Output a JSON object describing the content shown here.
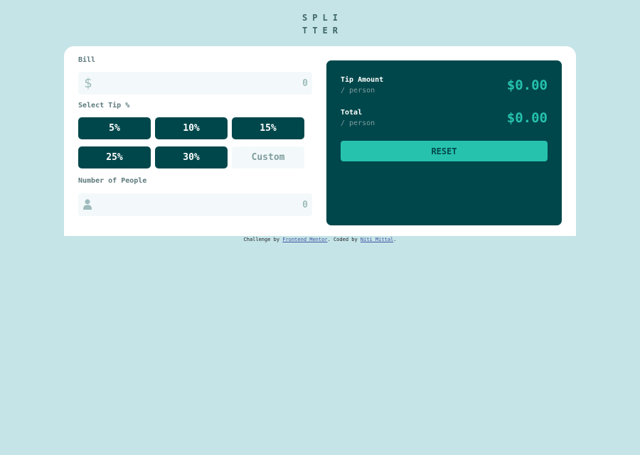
{
  "logo": {
    "line1": "SPLI",
    "line2": "TTER"
  },
  "bill": {
    "label": "Bill",
    "icon": "dollar-icon",
    "placeholder": "0"
  },
  "tip": {
    "label": "Select Tip %",
    "options": [
      "5%",
      "10%",
      "15%",
      "25%",
      "30%"
    ],
    "custom_placeholder": "Custom"
  },
  "people": {
    "label": "Number of People",
    "icon": "person-icon",
    "placeholder": "0"
  },
  "result": {
    "tip_title": "Tip Amount",
    "tip_sub": "/ person",
    "tip_value": "$0.00",
    "total_title": "Total",
    "total_sub": "/ person",
    "total_value": "$0.00",
    "reset_label": "RESET"
  },
  "attribution": {
    "prefix": "Challenge by ",
    "link1": "Frontend Mentor",
    "middle": ". Coded by ",
    "link2": "Niti Mittal",
    "suffix": "."
  },
  "colors": {
    "background": "#c5e4e7",
    "dark_cyan": "#00474b",
    "strong_cyan": "#26c2ad",
    "input_bg": "#f3f9fa"
  }
}
